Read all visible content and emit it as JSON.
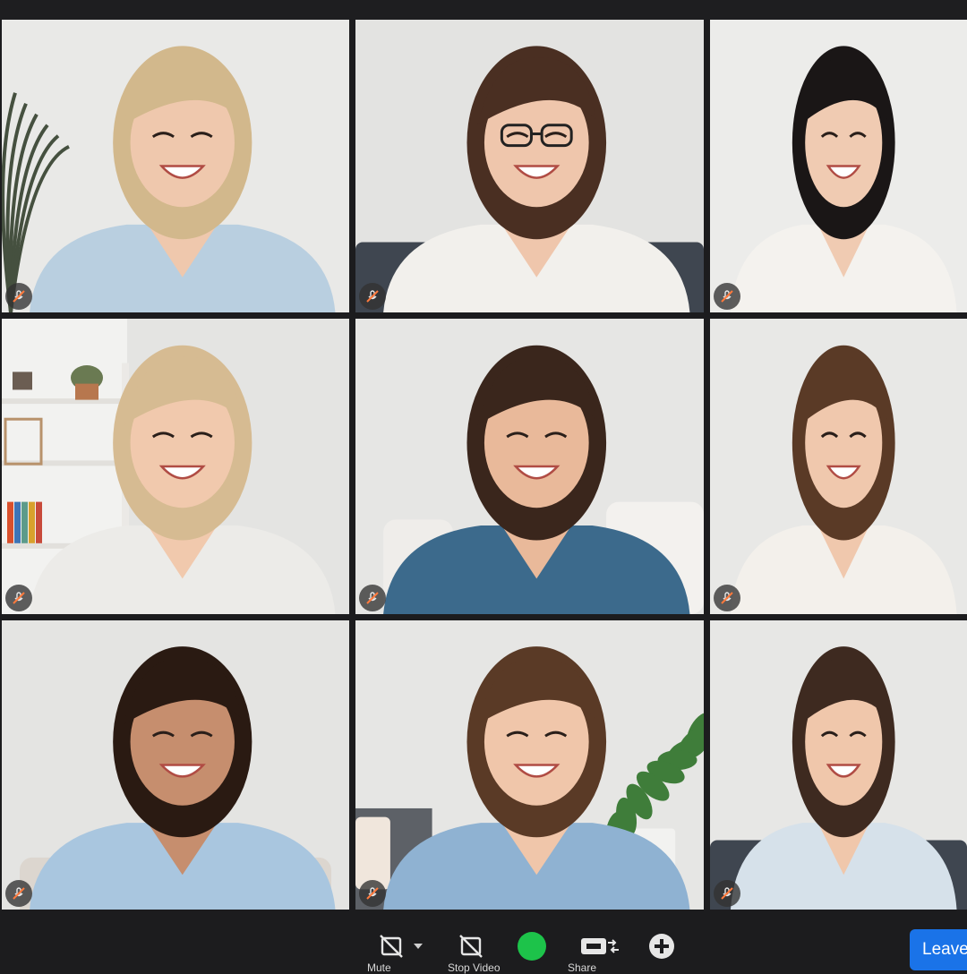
{
  "participants": [
    {
      "id": "p1",
      "muted": true,
      "wall": "#e9e9e7",
      "hair": "#d2b88c",
      "skin": "#efc8ad",
      "shirt": "#b9cfe0",
      "decor": "plant-left"
    },
    {
      "id": "p2",
      "muted": true,
      "wall": "#e3e3e1",
      "hair": "#4a2f22",
      "skin": "#efc6ac",
      "shirt": "#f2f0ec",
      "decor": "sofa",
      "glasses": true
    },
    {
      "id": "p3",
      "muted": true,
      "wall": "#ececea",
      "hair": "#1a1616",
      "skin": "#f0cbb2",
      "shirt": "#f4f2ee",
      "decor": "none"
    },
    {
      "id": "p4",
      "muted": true,
      "wall": "#e4e4e2",
      "hair": "#d6bb92",
      "skin": "#f1c9ad",
      "shirt": "#ecebe8",
      "decor": "shelves"
    },
    {
      "id": "p5",
      "muted": true,
      "wall": "#e6e6e4",
      "hair": "#3a261c",
      "skin": "#e9b99a",
      "shirt": "#3c6a8c",
      "decor": "pillows"
    },
    {
      "id": "p6",
      "muted": true,
      "wall": "#e8e8e6",
      "hair": "#5a3a26",
      "skin": "#f0c8ad",
      "shirt": "#f3f0eb",
      "decor": "none"
    },
    {
      "id": "p7",
      "muted": true,
      "wall": "#e4e4e2",
      "hair": "#2a1a12",
      "skin": "#c68e6e",
      "shirt": "#a9c6df",
      "decor": "sofa-light"
    },
    {
      "id": "p8",
      "muted": true,
      "wall": "#e6e6e4",
      "hair": "#5a3a26",
      "skin": "#f0c6aa",
      "shirt": "#8fb2d2",
      "decor": "plant-right"
    },
    {
      "id": "p9",
      "muted": true,
      "wall": "#e7e7e5",
      "hair": "#3e2a20",
      "skin": "#f0c7ab",
      "shirt": "#d6e1ea",
      "decor": "sofa-dark"
    }
  ],
  "controls": {
    "mute_label": "Mute",
    "video_label": "Stop Video",
    "share_label": "Share",
    "leave_label": "Leave"
  },
  "colors": {
    "share_active": "#1dc34a",
    "leave_button": "#1a73e8",
    "mute_badge_slash": "#ff7a3d"
  }
}
